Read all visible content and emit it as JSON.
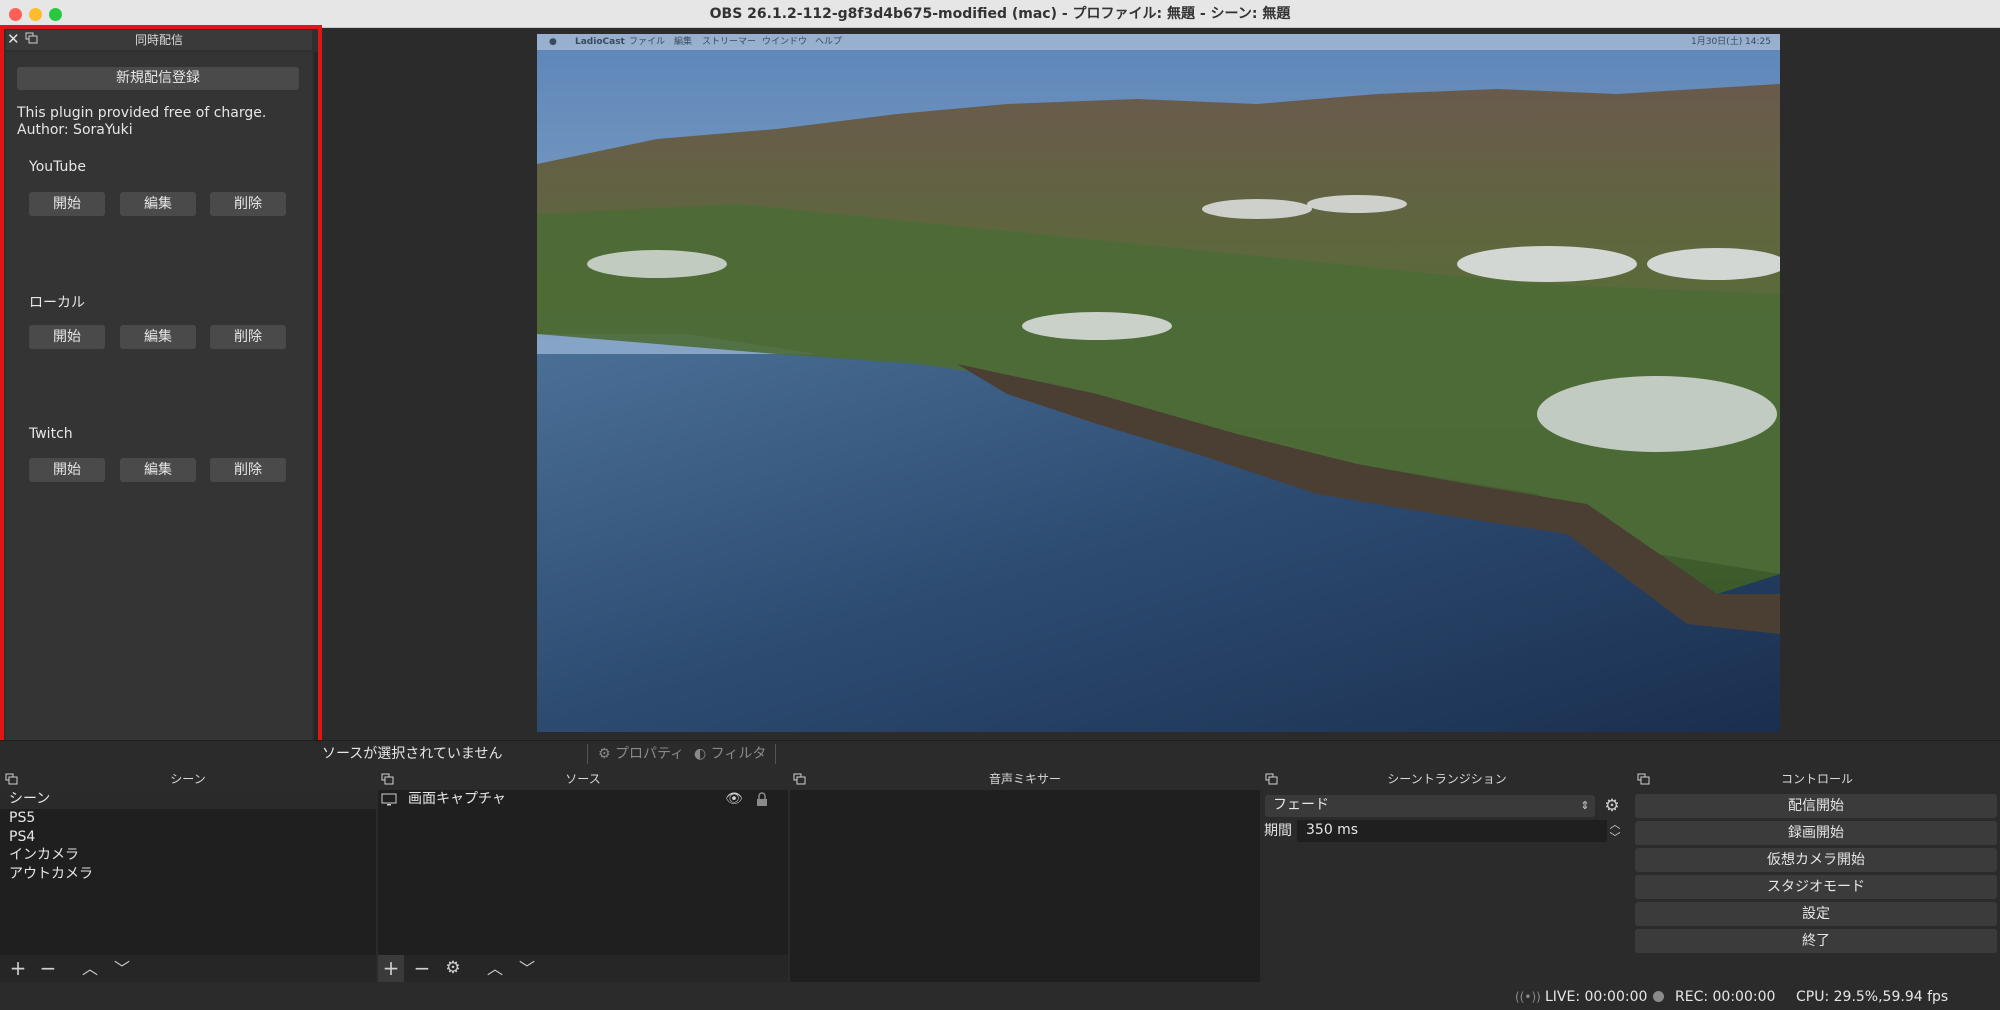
{
  "window": {
    "title": "OBS 26.1.2-112-g8f3d4b675-modified (mac) - プロファイル: 無題 - シーン: 無題",
    "traffic_colors": [
      "#ff5f57",
      "#febc2e",
      "#28c840"
    ]
  },
  "plugin_dock": {
    "title": "同時配信",
    "register_button": "新規配信登録",
    "info_line1": "This plugin provided free of charge.",
    "info_line2": "Author: SoraYuki",
    "highlight_color": "#e01616",
    "targets": [
      {
        "name": "YouTube",
        "start": "開始",
        "edit": "編集",
        "delete": "削除"
      },
      {
        "name": "ローカル",
        "start": "開始",
        "edit": "編集",
        "delete": "削除"
      },
      {
        "name": "Twitch",
        "start": "開始",
        "edit": "編集",
        "delete": "削除"
      }
    ]
  },
  "preview_menubar": {
    "app": "LadioCast",
    "items": [
      "ファイル",
      "編集",
      "ストリーマー",
      "ウインドウ",
      "ヘルプ"
    ],
    "clock": "1月30日(土) 14:25"
  },
  "status_strip": {
    "no_source": "ソースが選択されていません",
    "properties": "プロパティ",
    "filters": "フィルタ"
  },
  "panels": {
    "scenes": {
      "title": "シーン",
      "items": [
        "シーン",
        "PS5",
        "PS4",
        "インカメラ",
        "アウトカメラ"
      ]
    },
    "sources": {
      "title": "ソース",
      "items": [
        "画面キャプチャ"
      ]
    },
    "mixer": {
      "title": "音声ミキサー"
    },
    "transitions": {
      "title": "シーントランジション",
      "selected": "フェード",
      "duration_label": "期間",
      "duration_value": "350 ms"
    },
    "controls": {
      "title": "コントロール",
      "buttons": [
        "配信開始",
        "録画開始",
        "仮想カメラ開始",
        "スタジオモード",
        "設定",
        "終了"
      ]
    }
  },
  "statusbar": {
    "live": "LIVE: 00:00:00",
    "rec": "REC: 00:00:00",
    "cpu": "CPU: 29.5%,59.94 fps"
  }
}
